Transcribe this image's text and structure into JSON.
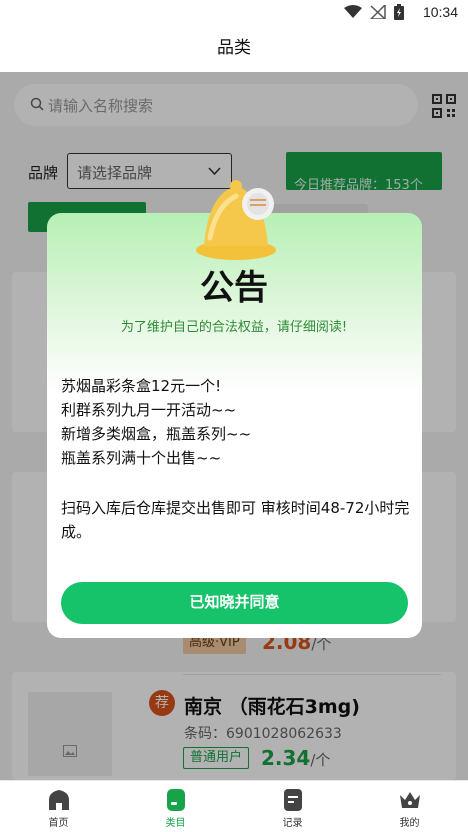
{
  "status_bar": {
    "time": "10:34"
  },
  "header": {
    "title": "品类"
  },
  "search": {
    "placeholder": "请输入名称搜索"
  },
  "filter": {
    "brand_label": "品牌",
    "brand_select_placeholder": "请选择品牌",
    "today_reco": "今日推荐品牌：153个"
  },
  "product": {
    "reco_badge": "荐",
    "name": "南京 （雨花石3mg)",
    "barcode": "条码：6901028062633",
    "normal_tier": "普通用户",
    "normal_price": "2.34",
    "unit": "/个"
  },
  "prev_product": {
    "vip_tier": "高级·VIP",
    "vip_price": "2.08",
    "unit": "/个"
  },
  "modal": {
    "title": "公告",
    "subtitle": "为了维护自己的合法权益，请仔细阅读!",
    "lines": [
      "苏烟晶彩条盒12元一个!",
      "利群系列九月一开活动~~",
      "新增多类烟盒，瓶盖系列~~",
      "瓶盖系列满十个出售~~"
    ],
    "paragraph": "扫码入库后仓库提交出售即可 审核时间48-72小时完成。",
    "agree_button": "已知晓并同意"
  },
  "bottom_nav": {
    "items": [
      {
        "label": "首页",
        "icon": "home-icon"
      },
      {
        "label": "类目",
        "icon": "category-icon",
        "active": true
      },
      {
        "label": "记录",
        "icon": "record-icon"
      },
      {
        "label": "我的",
        "icon": "crown-icon"
      }
    ]
  },
  "colors": {
    "primary_green": "#17a34a",
    "button_green": "#16c26a",
    "vip_orange": "#d9531e"
  }
}
